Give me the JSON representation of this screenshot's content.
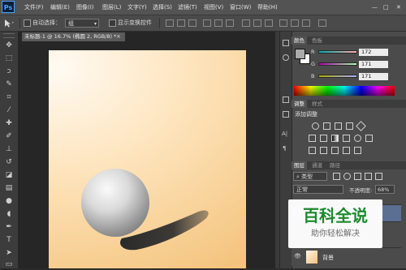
{
  "app": {
    "logo": "Ps"
  },
  "menu": [
    "文件(F)",
    "编辑(E)",
    "图像(I)",
    "图层(L)",
    "文字(Y)",
    "选择(S)",
    "滤镜(T)",
    "视图(V)",
    "窗口(W)",
    "帮助(H)"
  ],
  "window_controls": {
    "minimize": "—",
    "restore": "□",
    "close": "✕"
  },
  "options_bar": {
    "auto_select_label": "自动选择：",
    "auto_select_value": "组",
    "show_transform_label": "显示变换控件"
  },
  "document": {
    "tab_title": "未标题-1 @ 16.7% (椭圆 2, RGB/8) *",
    "close_glyph": "×"
  },
  "color_panel": {
    "tabs": [
      "颜色",
      "色板"
    ],
    "channels": [
      {
        "label": "R",
        "value": "172"
      },
      {
        "label": "G",
        "value": "171"
      },
      {
        "label": "B",
        "value": "171"
      }
    ],
    "foreground": "#acabab",
    "background": "#ffffff"
  },
  "adjustments_panel": {
    "tabs": [
      "调整",
      "样式"
    ],
    "heading": "添加调整"
  },
  "layers_panel": {
    "tabs": [
      "图层",
      "通道",
      "路径"
    ],
    "filter_label": "类型",
    "blend_mode": "正常",
    "opacity_label": "不透明度:",
    "opacity_value": "68%",
    "layer_name": "背景"
  },
  "watermark": {
    "title": "百科全说",
    "subtitle": "助你轻松解决"
  },
  "colors": {
    "accent": "#1c8a2e",
    "canvas_light": "#fffaf2",
    "canvas_dark": "#f4c37c",
    "panel": "#4b4b4b"
  },
  "icons": [
    "move-tool-icon",
    "marquee-tool-icon",
    "lasso-tool-icon",
    "quick-select-icon",
    "crop-tool-icon",
    "eyedropper-icon",
    "healing-brush-icon",
    "brush-tool-icon",
    "clone-stamp-icon",
    "history-brush-icon",
    "eraser-icon",
    "gradient-icon",
    "blur-icon",
    "dodge-icon",
    "pen-tool-icon",
    "type-tool-icon",
    "path-select-icon",
    "shape-tool-icon",
    "hand-tool-icon",
    "zoom-tool-icon"
  ]
}
